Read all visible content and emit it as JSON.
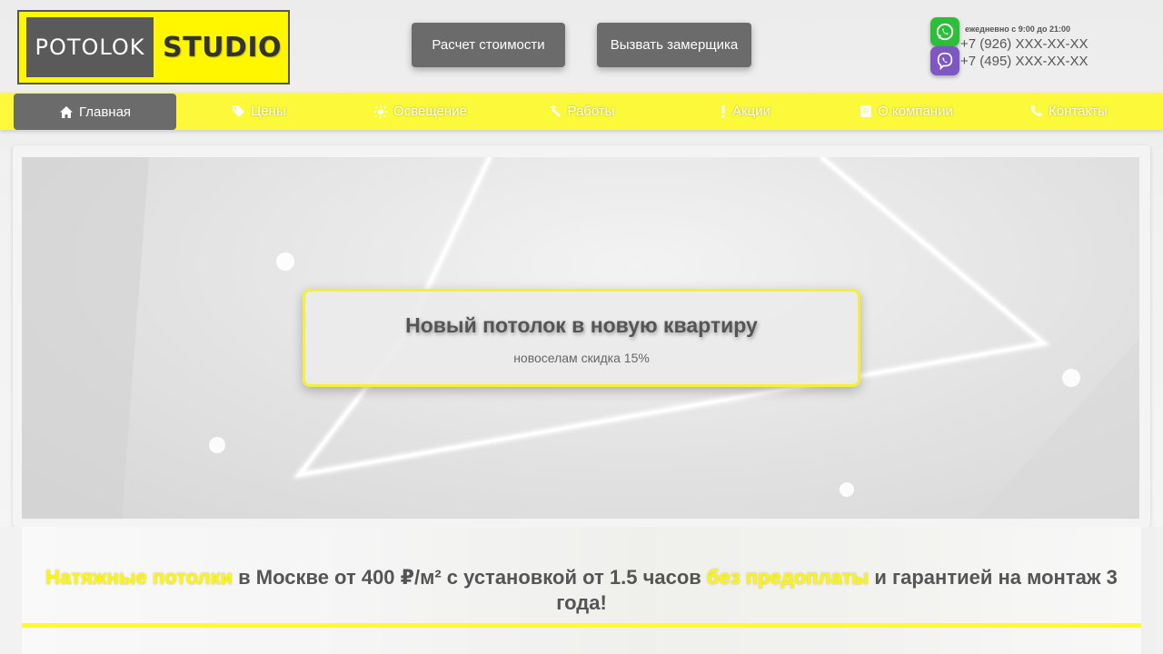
{
  "header": {
    "logo": {
      "left": "POTOLOK",
      "right": "STUDIO"
    },
    "buttons": {
      "calc": "Расчет стоимости",
      "measure": "Вызвать замерщика"
    },
    "contacts": {
      "hours": "ежедневно с 9:00 до 21:00",
      "phone1": "+7 (926) XXX-XX-XX",
      "phone2": "+7 (495) XXX-XX-XX",
      "icons": [
        "whatsapp-icon",
        "viber-icon"
      ]
    }
  },
  "nav": {
    "items": [
      {
        "label": "Главная",
        "icon": "home-icon",
        "active": true
      },
      {
        "label": "Цены",
        "icon": "tag-icon"
      },
      {
        "label": "Освещение",
        "icon": "sun-icon"
      },
      {
        "label": "Работы",
        "icon": "hammer-icon"
      },
      {
        "label": "Акции",
        "icon": "exclamation-icon"
      },
      {
        "label": "О компании",
        "icon": "book-icon"
      },
      {
        "label": "Контакты",
        "icon": "phone-icon"
      }
    ]
  },
  "hero": {
    "title": "Новый потолок в новую квартиру",
    "subtitle": "новоселам скидка 15%"
  },
  "tagline": {
    "hl1": "Натяжные потолки",
    "part1": " в Москве от 400 ₽/м² с установкой от 1.5 часов ",
    "hl2": "без предоплаты",
    "part2": " и гарантией на монтаж 3 года!"
  },
  "colors": {
    "accent_yellow": "#fbf93a",
    "button_gray": "#6b6b6b",
    "whatsapp_green": "#2fbe3c",
    "viber_purple": "#7e57c2"
  }
}
